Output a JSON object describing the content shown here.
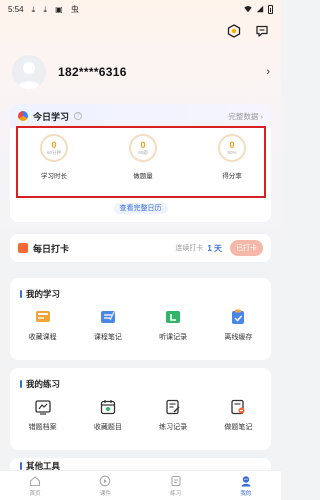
{
  "status_bar": {
    "time": "5:54",
    "icons": "⤓ ⤓ ▣ 虫"
  },
  "profile": {
    "phone": "182****6316",
    "chevron": "›"
  },
  "study": {
    "title": "今日学习",
    "help": "?",
    "more": "完整数据 ›",
    "stats": [
      {
        "value": "0",
        "unit": "60分钟",
        "label": "学习时长"
      },
      {
        "value": "0",
        "unit": "60题",
        "label": "做题量"
      },
      {
        "value": "0",
        "unit": "60%",
        "label": "得分率"
      }
    ],
    "calendar_link": "查看完整日历"
  },
  "checkin": {
    "title": "每日打卡",
    "streak_label": "连续打卡",
    "streak_days": "1 天",
    "button": "已打卡"
  },
  "my_study": {
    "title": "我的学习",
    "items": [
      {
        "label": "收藏课程",
        "icon": "course-bookmark-icon"
      },
      {
        "label": "课程笔记",
        "icon": "course-notes-icon"
      },
      {
        "label": "听课记录",
        "icon": "listen-record-icon"
      },
      {
        "label": "离线缓存",
        "icon": "offline-cache-icon"
      }
    ]
  },
  "my_practice": {
    "title": "我的练习",
    "items": [
      {
        "label": "错题档案",
        "icon": "wrong-questions-icon"
      },
      {
        "label": "收藏题目",
        "icon": "bookmarked-questions-icon"
      },
      {
        "label": "练习记录",
        "icon": "practice-record-icon"
      },
      {
        "label": "做题笔记",
        "icon": "question-notes-icon"
      }
    ]
  },
  "other_tools": {
    "title": "其他工具"
  },
  "tabbar": {
    "items": [
      {
        "label": "首页"
      },
      {
        "label": "课件"
      },
      {
        "label": "练习"
      },
      {
        "label": "我的"
      }
    ]
  },
  "colors": {
    "accent": "#3b6fd8",
    "highlight": "#d91f26",
    "stat": "#f0a020"
  }
}
